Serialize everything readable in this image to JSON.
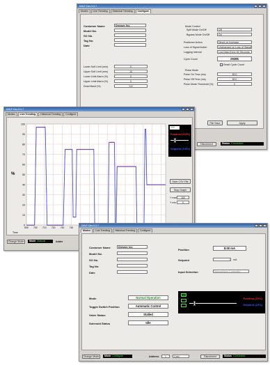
{
  "colors": {
    "position": "#ff2a2a",
    "setpoint": "#2b63ff",
    "status_ok": "#4ce04c",
    "title_start": "#2a5fa8"
  },
  "back_window": {
    "title": "DHLF Dev 0.0.7",
    "tabs": [
      "Modes",
      "Live Trending",
      "Historical Trending",
      "Configure"
    ],
    "customer_name_label": "Customer Name",
    "customer_name_value": "Dresser, Inc.",
    "fields": [
      "Model No.",
      "SO No.",
      "Tag No.",
      "Date"
    ],
    "limits": [
      {
        "label": "Lower Soft Limit (mm)",
        "value": "0"
      },
      {
        "label": "Upper Soft Limit (mm)",
        "value": "10"
      },
      {
        "label": "Lower Limit Alarm (%)",
        "value": "0"
      },
      {
        "label": "Upper Limit Alarm (%)",
        "value": "0"
      },
      {
        "label": "Dead Band (%)",
        "value": "0.5"
      }
    ],
    "mode_control": "Mode Control",
    "split_mode": {
      "label": "Split Mode On/Off",
      "value": "Off"
    },
    "bypass_mode": {
      "label": "Bypass Mode On/Off",
      "value": "On"
    },
    "position_action": {
      "label": "Positioner Action",
      "value": "Direct on Increase"
    },
    "loss_of_signal": {
      "label": "Loss of Signal Action",
      "value": "Unchanged on Loss of Signal"
    },
    "logging_interval": {
      "label": "Logging Interval",
      "value": "Log Data Every 60 Seconds"
    },
    "cycle_count": {
      "label": "Cycle Count",
      "value": "29286"
    },
    "reset_cycle": "Reset Cycle Count",
    "pulse_mode": "Pulse Mode",
    "pulse_on": {
      "label": "Pulse On Time (ms)",
      "value": "50.0"
    },
    "pulse_off": {
      "label": "Pulse Off Time (ms)",
      "value": "50.0"
    },
    "pulse_threshold": {
      "label": "Pulse Mode Threshold (%)",
      "value": "0"
    },
    "file_save": "File Save",
    "apply": "Apply",
    "disconnect": "Disconnect",
    "status_label": "Status",
    "status_value": "Connected"
  },
  "middle_window": {
    "title": "DHLF Dev 0.0.7",
    "tabs": [
      "Modes",
      "Live Trending",
      "Historical Trending",
      "Configure"
    ],
    "y_unit": "%",
    "y_ticks": [
      "100",
      "90",
      "80",
      "70",
      "60",
      "50",
      "40",
      "30",
      "20",
      "10",
      "0"
    ],
    "x_ticks": [
      "690",
      "700",
      "710",
      "720",
      "730",
      "740",
      "750",
      "760",
      "770",
      "780",
      "790",
      "800",
      "810",
      "820",
      "830",
      "840"
    ],
    "x_axis_label": "Time",
    "legend_value": "100",
    "position_label": "Position (100%)",
    "setpoint_label": "Setpoint (100%)",
    "save_csv": "Save CSV File",
    "stop_graph": "Stop Graph",
    "y_max_label": "Y max",
    "y_max_value": "100",
    "y_min_label": "Y min",
    "y_min_value": "0",
    "change_mode": "Change Mode",
    "mode_label": "Mode",
    "mode_value": "Manual",
    "address_label": "Addre"
  },
  "front_window": {
    "title": "DHLF Dev 0.0.7",
    "tabs": [
      "Modes",
      "Live Trending",
      "Historical Trending",
      "Configure"
    ],
    "customer_name_label": "Customer Name",
    "customer_name_value": "Dresser, Inc.",
    "fields": [
      "Model No.",
      "SO No.",
      "Tag No.",
      "Date"
    ],
    "position_label": "Position",
    "position_value": "8.00 mA",
    "setpoint_label": "Setpoint",
    "setpoint_value": "0",
    "setpoint_unit": "mA",
    "input_selection_label": "Input Selection",
    "input_selection_value": "Manual/Auto Controlled",
    "mode_label": "Mode",
    "mode_value": "Normal Operation",
    "toggle_label": "Toggle Switch Position",
    "toggle_value": "Automatic Control",
    "valve_label": "Valve Status",
    "valve_value": "Stalled",
    "solenoid_label": "Solenoid Status",
    "solenoid_value": "Idle",
    "legend_value": "100",
    "position_legend": "Position (10%)",
    "setpoint_legend": "Setpoint (10%)",
    "change_mode": "Change Mode",
    "mode_status_label": "Mode",
    "mode_status_value": "Configure",
    "address_label": "Address",
    "address_value": "1",
    "port_value": "Com",
    "disconnect": "Disconnect",
    "status_label": "Status",
    "status_value": "Connected"
  },
  "chart_data": {
    "type": "line",
    "x_range": [
      690,
      845
    ],
    "ylim": [
      0,
      100
    ],
    "grid": true,
    "series": [
      {
        "name": "Position",
        "color": "#ff2a2a",
        "x": [
          690,
          699,
          701,
          711,
          713,
          731,
          733,
          741,
          742,
          745,
          746,
          765,
          766,
          781,
          782,
          788,
          789,
          790,
          791,
          812,
          813,
          821,
          822,
          823,
          824,
          845
        ],
        "y": [
          0,
          0,
          97,
          97,
          0,
          0,
          75,
          75,
          8,
          8,
          75,
          75,
          0,
          0,
          82,
          82,
          0,
          0,
          58,
          58,
          0,
          0,
          95,
          95,
          40,
          40
        ]
      },
      {
        "name": "Setpoint",
        "color": "#2b63ff",
        "x": [
          690,
          699,
          701,
          711,
          713,
          731,
          733,
          741,
          742,
          745,
          746,
          765,
          766,
          781,
          782,
          788,
          789,
          790,
          791,
          812,
          813,
          821,
          822,
          823,
          824,
          845
        ],
        "y": [
          0,
          0,
          97,
          97,
          0,
          0,
          75,
          75,
          8,
          8,
          75,
          75,
          0,
          0,
          82,
          82,
          0,
          0,
          58,
          58,
          0,
          0,
          95,
          95,
          40,
          40
        ]
      }
    ]
  }
}
